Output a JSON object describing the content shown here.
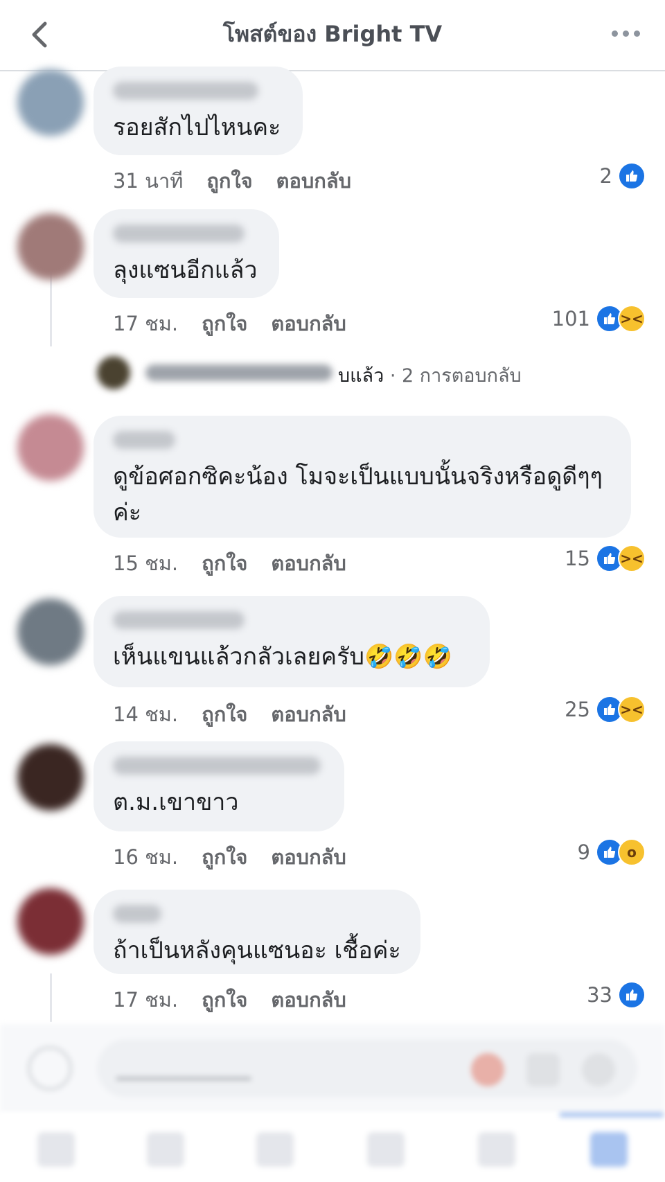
{
  "header": {
    "title": "โพสต์ของ Bright TV"
  },
  "comments": [
    {
      "text": "รอยสักไปไหนคะ",
      "time": "31 นาที",
      "like_label": "ถูกใจ",
      "reply_label": "ตอบกลับ",
      "reaction_count": "2",
      "reactions": [
        "like"
      ]
    },
    {
      "text": "ลุงแซนอีกแล้ว",
      "time": "17 ชม.",
      "like_label": "ถูกใจ",
      "reply_label": "ตอบกลับ",
      "reaction_count": "101",
      "reactions": [
        "like",
        "haha"
      ]
    },
    {
      "text": "ดูข้อศอกซิคะน้อง โมจะเป็นแบบนั้นจริงหรือดูดีๆๆค่ะ",
      "time": "15 ชม.",
      "like_label": "ถูกใจ",
      "reply_label": "ตอบกลับ",
      "reaction_count": "15",
      "reactions": [
        "like",
        "haha"
      ]
    },
    {
      "text": "เห็นแขนแล้วกลัวเลยครับ🤣🤣🤣",
      "time": "14 ชม.",
      "like_label": "ถูกใจ",
      "reply_label": "ตอบกลับ",
      "reaction_count": "25",
      "reactions": [
        "like",
        "haha"
      ]
    },
    {
      "text": "ต.ม.เขาขาว",
      "time": "16 ชม.",
      "like_label": "ถูกใจ",
      "reply_label": "ตอบกลับ",
      "reaction_count": "9",
      "reactions": [
        "like",
        "wow"
      ]
    },
    {
      "text": "ถ้าเป็นหลังคุนแซนอะ เชื้อค่ะ",
      "time": "17 ชม.",
      "like_label": "ถูกใจ",
      "reply_label": "ตอบกลับ",
      "reaction_count": "33",
      "reactions": [
        "like"
      ]
    }
  ],
  "reply_preview": {
    "text_suffix": "บแล้ว",
    "count": " · 2 การตอบกลับ"
  },
  "icons": {
    "back": "chevron-left-icon",
    "more": "more-dots-icon",
    "like": "thumbs-up-icon",
    "haha": "laughing-face-icon",
    "wow": "surprised-face-icon"
  },
  "colors": {
    "accent": "#1b74e4",
    "bubble": "#f0f2f5",
    "meta": "#65676b"
  }
}
